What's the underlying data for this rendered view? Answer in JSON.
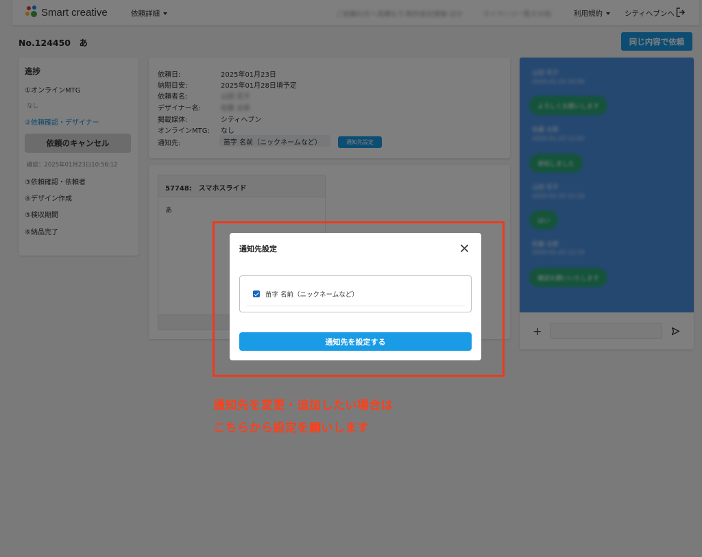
{
  "header": {
    "logo_text": "Smart creative",
    "nav_request_detail": "依頼詳細",
    "blurred_1": "ご依頼の方へ見積もり",
    "blurred_2": "制作会社情報 ほか",
    "blurred_3": "マイページ一覧その他",
    "nav_terms": "利用規約",
    "nav_user": "シティヘブンへ"
  },
  "page": {
    "title": "No.124450　あ",
    "same_request_button": "同じ内容で依頼"
  },
  "progress": {
    "title": "進捗",
    "step1": "①オンラインMTG",
    "step1_sub": "なし",
    "step2": "②依頼確認・デザイナー",
    "cancel_button": "依頼のキャンセル",
    "confirm_text": "確認：2025年01月23日10:56:12",
    "step3": "③依頼確認・依頼者",
    "step4": "④デザイン作成",
    "step5": "⑤検収期間",
    "step6": "⑥納品完了"
  },
  "info": {
    "request_date_label": "依頼日:",
    "request_date": "2025年01月23日",
    "delivery_label": "納期目安:",
    "delivery": "2025年01月28日頃予定",
    "requester_label": "依頼者名:",
    "requester": "山田 花子",
    "designer_label": "デザイナー名:",
    "designer": "佐藤 太郎",
    "media_label": "掲載媒体:",
    "media": "シティヘブン",
    "mtg_label": "オンラインMTG:",
    "mtg": "なし",
    "notify_label": "通知先:",
    "notify_value": "苗字 名前（ニックネームなど）",
    "notify_button": "通知先設定"
  },
  "file": {
    "header": "57748:　スマホスライド",
    "body": "あ"
  },
  "chat": {
    "messages": [
      {
        "name": "山田 花子",
        "time": "2025-01-23 10:56",
        "text": "よろしくお願いします"
      },
      {
        "name": "佐藤 太郎",
        "time": "2025-01-23 11:02",
        "text": "承知しました"
      },
      {
        "name": "山田 花子",
        "time": "2025-01-23 11:10",
        "text": "はい"
      },
      {
        "name": "佐藤 太郎",
        "time": "2025-01-23 11:15",
        "text": "確認お願いいたします"
      }
    ],
    "plus": "+"
  },
  "modal": {
    "title": "通知先設定",
    "recipient_label": "苗字 名前（ニックネームなど）",
    "submit_button": "通知先を設定する"
  },
  "annotation": {
    "line1": "通知先を変更・追加したい場合は",
    "line2": "こちらから設定を願いします"
  },
  "colors": {
    "accent": "#1a9be6",
    "chat_bg": "#4a90e2",
    "annotation": "#ff3f1a"
  }
}
